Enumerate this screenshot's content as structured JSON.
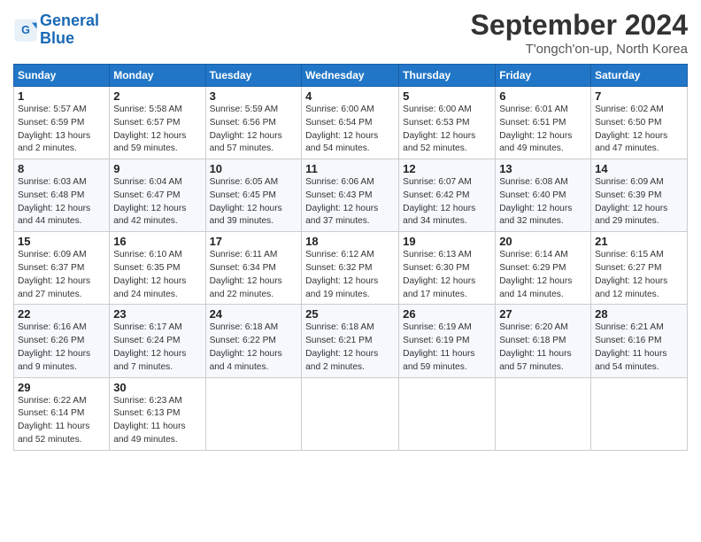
{
  "header": {
    "logo_line1": "General",
    "logo_line2": "Blue",
    "month_title": "September 2024",
    "location": "T'ongch'on-up, North Korea"
  },
  "weekdays": [
    "Sunday",
    "Monday",
    "Tuesday",
    "Wednesday",
    "Thursday",
    "Friday",
    "Saturday"
  ],
  "weeks": [
    [
      {
        "day": "1",
        "info": "Sunrise: 5:57 AM\nSunset: 6:59 PM\nDaylight: 13 hours\nand 2 minutes."
      },
      {
        "day": "2",
        "info": "Sunrise: 5:58 AM\nSunset: 6:57 PM\nDaylight: 12 hours\nand 59 minutes."
      },
      {
        "day": "3",
        "info": "Sunrise: 5:59 AM\nSunset: 6:56 PM\nDaylight: 12 hours\nand 57 minutes."
      },
      {
        "day": "4",
        "info": "Sunrise: 6:00 AM\nSunset: 6:54 PM\nDaylight: 12 hours\nand 54 minutes."
      },
      {
        "day": "5",
        "info": "Sunrise: 6:00 AM\nSunset: 6:53 PM\nDaylight: 12 hours\nand 52 minutes."
      },
      {
        "day": "6",
        "info": "Sunrise: 6:01 AM\nSunset: 6:51 PM\nDaylight: 12 hours\nand 49 minutes."
      },
      {
        "day": "7",
        "info": "Sunrise: 6:02 AM\nSunset: 6:50 PM\nDaylight: 12 hours\nand 47 minutes."
      }
    ],
    [
      {
        "day": "8",
        "info": "Sunrise: 6:03 AM\nSunset: 6:48 PM\nDaylight: 12 hours\nand 44 minutes."
      },
      {
        "day": "9",
        "info": "Sunrise: 6:04 AM\nSunset: 6:47 PM\nDaylight: 12 hours\nand 42 minutes."
      },
      {
        "day": "10",
        "info": "Sunrise: 6:05 AM\nSunset: 6:45 PM\nDaylight: 12 hours\nand 39 minutes."
      },
      {
        "day": "11",
        "info": "Sunrise: 6:06 AM\nSunset: 6:43 PM\nDaylight: 12 hours\nand 37 minutes."
      },
      {
        "day": "12",
        "info": "Sunrise: 6:07 AM\nSunset: 6:42 PM\nDaylight: 12 hours\nand 34 minutes."
      },
      {
        "day": "13",
        "info": "Sunrise: 6:08 AM\nSunset: 6:40 PM\nDaylight: 12 hours\nand 32 minutes."
      },
      {
        "day": "14",
        "info": "Sunrise: 6:09 AM\nSunset: 6:39 PM\nDaylight: 12 hours\nand 29 minutes."
      }
    ],
    [
      {
        "day": "15",
        "info": "Sunrise: 6:09 AM\nSunset: 6:37 PM\nDaylight: 12 hours\nand 27 minutes."
      },
      {
        "day": "16",
        "info": "Sunrise: 6:10 AM\nSunset: 6:35 PM\nDaylight: 12 hours\nand 24 minutes."
      },
      {
        "day": "17",
        "info": "Sunrise: 6:11 AM\nSunset: 6:34 PM\nDaylight: 12 hours\nand 22 minutes."
      },
      {
        "day": "18",
        "info": "Sunrise: 6:12 AM\nSunset: 6:32 PM\nDaylight: 12 hours\nand 19 minutes."
      },
      {
        "day": "19",
        "info": "Sunrise: 6:13 AM\nSunset: 6:30 PM\nDaylight: 12 hours\nand 17 minutes."
      },
      {
        "day": "20",
        "info": "Sunrise: 6:14 AM\nSunset: 6:29 PM\nDaylight: 12 hours\nand 14 minutes."
      },
      {
        "day": "21",
        "info": "Sunrise: 6:15 AM\nSunset: 6:27 PM\nDaylight: 12 hours\nand 12 minutes."
      }
    ],
    [
      {
        "day": "22",
        "info": "Sunrise: 6:16 AM\nSunset: 6:26 PM\nDaylight: 12 hours\nand 9 minutes."
      },
      {
        "day": "23",
        "info": "Sunrise: 6:17 AM\nSunset: 6:24 PM\nDaylight: 12 hours\nand 7 minutes."
      },
      {
        "day": "24",
        "info": "Sunrise: 6:18 AM\nSunset: 6:22 PM\nDaylight: 12 hours\nand 4 minutes."
      },
      {
        "day": "25",
        "info": "Sunrise: 6:18 AM\nSunset: 6:21 PM\nDaylight: 12 hours\nand 2 minutes."
      },
      {
        "day": "26",
        "info": "Sunrise: 6:19 AM\nSunset: 6:19 PM\nDaylight: 11 hours\nand 59 minutes."
      },
      {
        "day": "27",
        "info": "Sunrise: 6:20 AM\nSunset: 6:18 PM\nDaylight: 11 hours\nand 57 minutes."
      },
      {
        "day": "28",
        "info": "Sunrise: 6:21 AM\nSunset: 6:16 PM\nDaylight: 11 hours\nand 54 minutes."
      }
    ],
    [
      {
        "day": "29",
        "info": "Sunrise: 6:22 AM\nSunset: 6:14 PM\nDaylight: 11 hours\nand 52 minutes."
      },
      {
        "day": "30",
        "info": "Sunrise: 6:23 AM\nSunset: 6:13 PM\nDaylight: 11 hours\nand 49 minutes."
      },
      null,
      null,
      null,
      null,
      null
    ]
  ]
}
